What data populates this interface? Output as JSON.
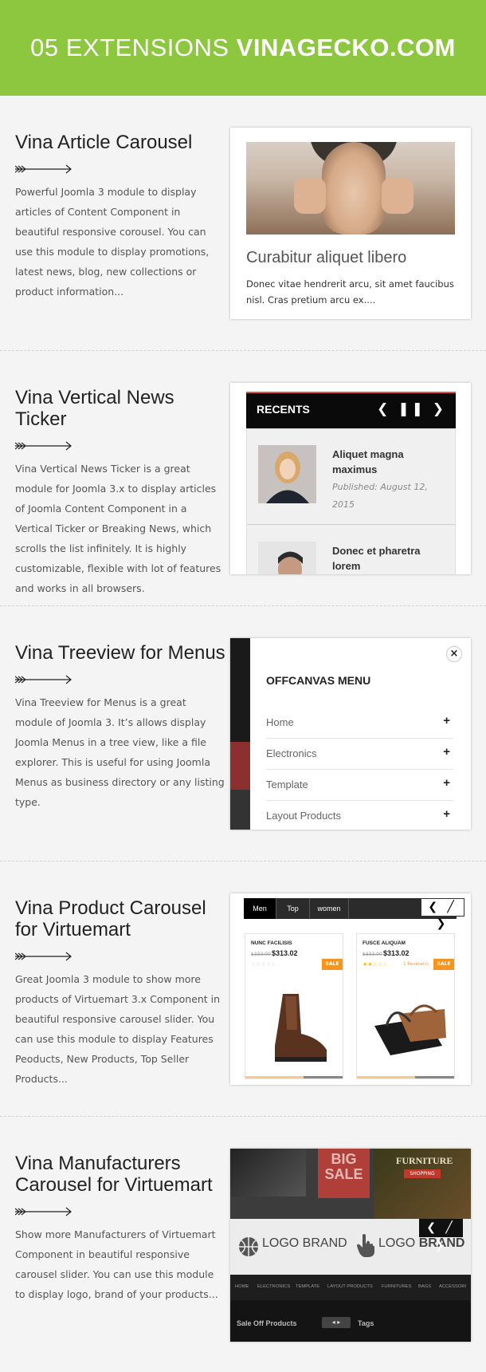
{
  "header": {
    "title_light": "05 EXTENSIONS",
    "title_bold": "VINAGECKO.COM"
  },
  "sections": [
    {
      "title": "Vina Article Carousel",
      "description": "Powerful Joomla 3 module to display articles of Content Component in beautiful responsive corousel. You can use this module to display promotions, latest news, blog, new collections or product information...",
      "preview": {
        "title": "Curabitur aliquet libero",
        "text": "Donec vitae hendrerit arcu, sit amet faucibus nisl. Cras pretium arcu ex...."
      }
    },
    {
      "title": "Vina Vertical News Ticker",
      "description": "Vina Vertical News Ticker is a great module for Joomla 3.x to display articles of Joomla Content Component in a Vertical Ticker or Breaking News, which scrolls the list infinitely. It is highly customizable, flexible with lot of features and works in all browsers.",
      "preview": {
        "bar_label": "RECENTS",
        "nav": "❮ ❚❚ ❯",
        "items": [
          {
            "title": "Aliquet magna maximus",
            "date": "Published: August 12, 2015"
          },
          {
            "title": "Donec et pharetra lorem",
            "date": ""
          }
        ]
      }
    },
    {
      "title": "Vina Treeview for Menus",
      "description": "Vina Treeview for Menus is a great module of Joomla 3. It’s allows display Joomla Menus in a tree view, like a file explorer. This is useful for using Joomla Menus as business directory or any listing type.",
      "preview": {
        "close": "×",
        "menu_title": "OFFCANVAS MENU",
        "items": [
          "Home",
          "Electronics",
          "Template",
          "Layout Products"
        ],
        "expand": "+"
      }
    },
    {
      "title_line1": "Vina Product Carousel",
      "title_line2": "for Virtuemart",
      "description": "Great Joomla 3 module to show more products of Virtuemart 3.x Component in beautiful responsive carousel slider. You can use this module to display Features Peoducts, New Products, Top Seller Products...",
      "preview": {
        "tabs": [
          "Men",
          "Top",
          "women"
        ],
        "nav": "❮ ╱ ❯",
        "products": [
          {
            "name": "NUNC FACILISIS",
            "old_price": "$333.00",
            "price": "$313.02",
            "stars": "☆☆☆☆☆",
            "reviews": "",
            "sale": "SALE"
          },
          {
            "name": "FUSCE ALIQUAM",
            "old_price": "$333.00",
            "price": "$313.02",
            "stars": "★★☆☆☆",
            "reviews": "1 Review(s)",
            "sale": "SALE"
          }
        ]
      }
    },
    {
      "title_line1": "Vina Manufacturers",
      "title_line2": "Carousel for Virtuemart",
      "description": "Show more Manufacturers of Virtuemart Component in beautiful responsive carousel slider. You can use this module to display logo, brand of your products...",
      "preview": {
        "banner_big": "BIG",
        "banner_sale": "SALE",
        "banner_furniture": "FURNITURE",
        "banner_shopping": "SHOPPING",
        "nav": "❮ ╱ ❯",
        "brand1": "LOGO BRAND",
        "brand2_light": "LOGO",
        "brand2_bold": "BRAND",
        "menu": [
          "HOME",
          "ELECTRONICS",
          "TEMPLATE",
          "LAYOUT PRODUCTS",
          "FURNITURES",
          "BAGS",
          "ACCESSORI"
        ],
        "footer_left": "Sale Off Products",
        "footer_pager": "◂ ▸",
        "footer_right": "Tags"
      }
    }
  ]
}
